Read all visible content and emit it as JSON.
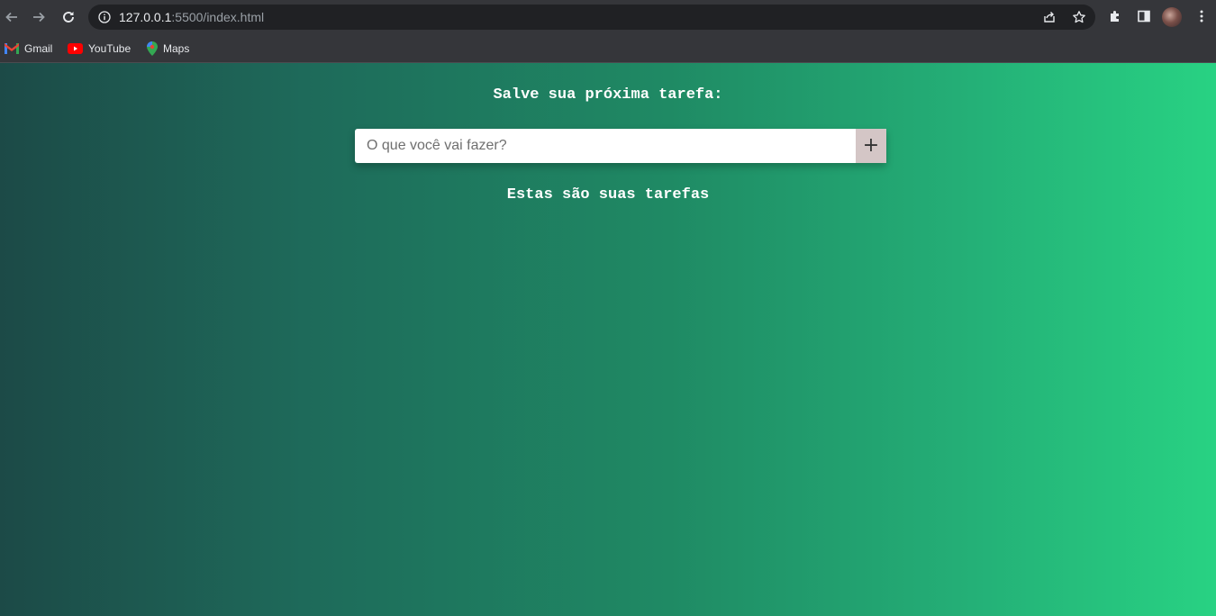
{
  "browser": {
    "url_host": "127.0.0.1",
    "url_path": ":5500/index.html",
    "bookmarks": [
      {
        "label": "Gmail",
        "icon": "gmail-icon"
      },
      {
        "label": "YouTube",
        "icon": "youtube-icon"
      },
      {
        "label": "Maps",
        "icon": "maps-icon"
      }
    ],
    "colors": {
      "toolbar": "#35363a",
      "omnibox": "#202124"
    }
  },
  "page": {
    "title": "Salve sua próxima tarefa:",
    "input_placeholder": "O que você vai fazer?",
    "add_button_label": "+",
    "tasks_heading": "Estas são suas tarefas",
    "colors": {
      "gradient_start": "#1c4a47",
      "gradient_end": "#28d283",
      "button": "#d4c6c6"
    }
  }
}
